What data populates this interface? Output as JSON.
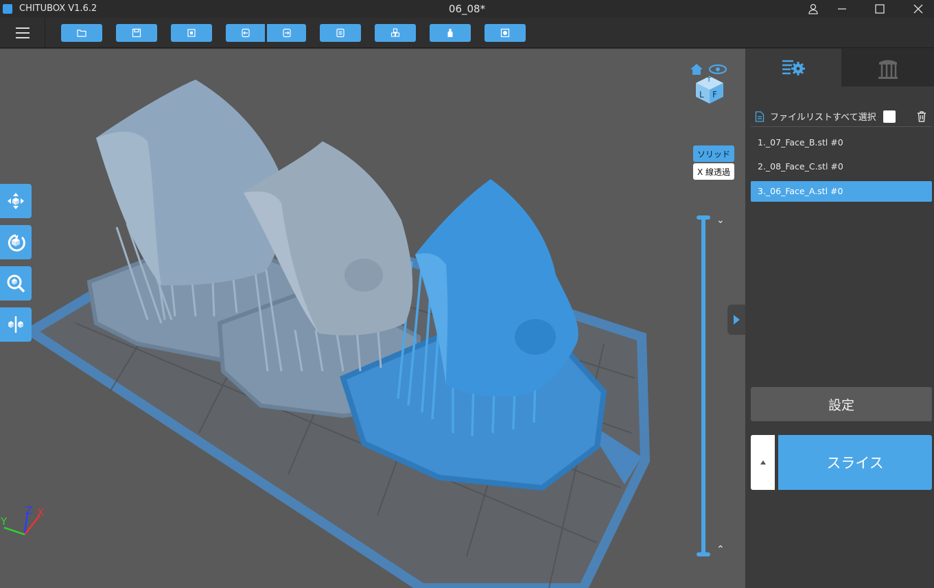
{
  "window": {
    "app_title": "CHITUBOX V1.6.2",
    "document_title": "06_08*"
  },
  "toolbar": {
    "menu_icon": "hamburger-menu-icon",
    "buttons": [
      {
        "icon": "open-folder-icon"
      },
      {
        "icon": "save-icon"
      },
      {
        "icon": "screenshot-icon"
      },
      {
        "icon": "import-icon"
      },
      {
        "icon": "export-icon"
      },
      {
        "icon": "file-list-icon"
      },
      {
        "icon": "cubes-icon"
      },
      {
        "icon": "bottle-icon"
      },
      {
        "icon": "record-icon"
      }
    ]
  },
  "viewport": {
    "view_modes": {
      "solid": "ソリッド",
      "xray": "X 線透過"
    },
    "cube_labels": {
      "top": "T",
      "left": "L",
      "front": "F"
    },
    "axes": {
      "x": "X",
      "y": "Y",
      "z": "Z"
    }
  },
  "panel": {
    "file_list_header": "ファイルリストすべて選択",
    "files": [
      {
        "name": "1._07_Face_B.stl #0",
        "selected": false
      },
      {
        "name": "2._08_Face_C.stl #0",
        "selected": false
      },
      {
        "name": "3._06_Face_A.stl #0",
        "selected": true
      }
    ],
    "settings_label": "設定",
    "slice_label": "スライス"
  },
  "colors": {
    "accent": "#4ba6e8",
    "viewport_bg": "#5a5a5a",
    "panel_bg": "#3b3b3b"
  }
}
